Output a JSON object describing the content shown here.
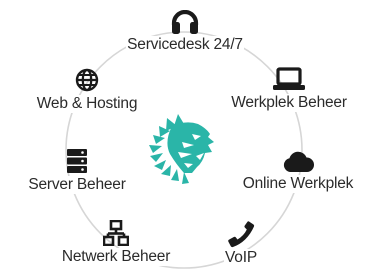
{
  "services": [
    {
      "label": "Servicedesk 24/7",
      "icon": "headset-icon"
    },
    {
      "label": "Web & Hosting",
      "icon": "globe-icon"
    },
    {
      "label": "Werkplek Beheer",
      "icon": "laptop-icon"
    },
    {
      "label": "Server Beheer",
      "icon": "server-icon"
    },
    {
      "label": "Online Werkplek",
      "icon": "cloud-icon"
    },
    {
      "label": "Netwerk Beheer",
      "icon": "network-icon"
    },
    {
      "label": "VoIP",
      "icon": "phone-icon"
    }
  ],
  "colors": {
    "icon": "#1a1a1a",
    "text": "#2b2b2b",
    "ring": "#d6d6d6",
    "logo": "#2ab5a8"
  }
}
